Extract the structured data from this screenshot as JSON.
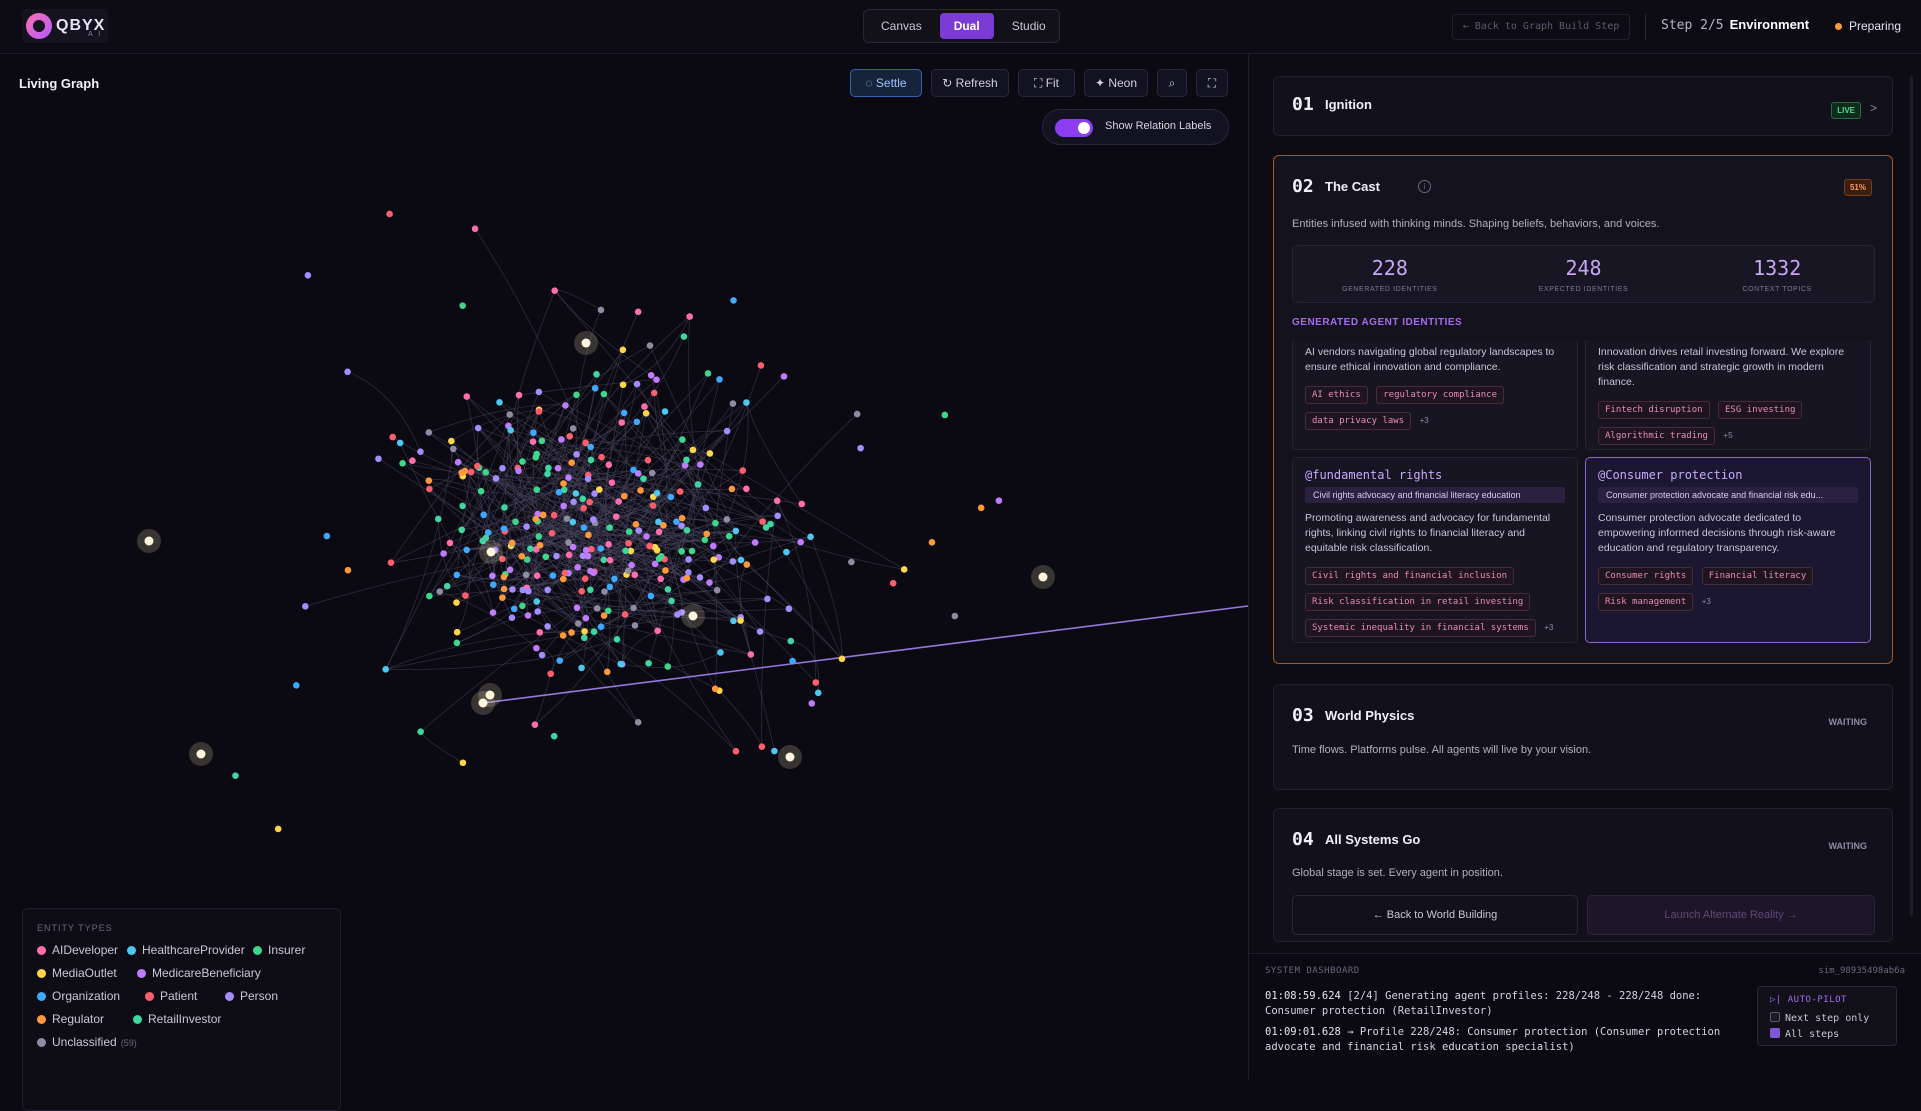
{
  "app": {
    "logo_text": "QBYX",
    "logo_sub": "A I"
  },
  "modes": [
    "Canvas",
    "Dual",
    "Studio"
  ],
  "active_mode": "Dual",
  "header": {
    "back_link": "← Back to Graph Build Step",
    "step_text": "Step 2/5",
    "step_name": "Environment",
    "status": "Preparing",
    "status_color": "#ff9a3c"
  },
  "graph": {
    "title": "Living Graph",
    "toolbar": {
      "settle": "Settle",
      "refresh": "Refresh",
      "fit": "Fit",
      "neon": "Neon"
    },
    "toggle_label": "Show Relation Labels",
    "toggle_on": true,
    "legend_title": "ENTITY TYPES",
    "legend": [
      {
        "label": "AIDeveloper",
        "color": "#ff6fae"
      },
      {
        "label": "HealthcareProvider",
        "color": "#4fc8f0"
      },
      {
        "label": "Insurer",
        "color": "#3fd68c"
      },
      {
        "label": "MediaOutlet",
        "color": "#ffd54a"
      },
      {
        "label": "MedicareBeneficiary",
        "color": "#c07cff"
      },
      {
        "label": "Organization",
        "color": "#3fa8ff"
      },
      {
        "label": "Patient",
        "color": "#ff5f6d"
      },
      {
        "label": "Person",
        "color": "#a58cff"
      },
      {
        "label": "Regulator",
        "color": "#ff9a3c"
      },
      {
        "label": "RetailInvestor",
        "color": "#3fd6a0"
      },
      {
        "label": "Unclassified",
        "color": "#8f8ba3",
        "count": "(59)"
      }
    ]
  },
  "steps": {
    "s1": {
      "num": "01",
      "title": "Ignition",
      "badge": "LIVE",
      "chevron": ">"
    },
    "s2": {
      "num": "02",
      "title": "The Cast",
      "badge": "51%",
      "desc": "Entities infused with thinking minds. Shaping beliefs, behaviors, and voices.",
      "stats": [
        {
          "value": "228",
          "label": "GENERATED IDENTITIES"
        },
        {
          "value": "248",
          "label": "EXPECTED IDENTITIES"
        },
        {
          "value": "1332",
          "label": "CONTEXT TOPICS"
        }
      ],
      "section_title": "GENERATED AGENT IDENTITIES",
      "agents": [
        {
          "handle": "",
          "bio": "AI vendors navigating global regulatory landscapes to ensure ethical innovation and compliance.",
          "tags": [
            "AI ethics",
            "regulatory compliance",
            "data privacy laws"
          ],
          "more": "+3"
        },
        {
          "handle": "",
          "bio": "Innovation drives retail investing forward. We explore risk classification and strategic growth in modern finance.",
          "tags": [
            "Fintech disruption",
            "ESG investing",
            "Algorithmic trading"
          ],
          "more": "+5"
        },
        {
          "handle": "@fundamental rights",
          "role": "Civil rights advocacy and financial literacy education",
          "bio": "Promoting awareness and advocacy for fundamental rights, linking civil rights to financial literacy and equitable risk classification.",
          "tags": [
            "Civil rights and financial inclusion",
            "Risk classification in retail investing",
            "Systemic inequality in financial systems"
          ],
          "more": "+3"
        },
        {
          "handle": "@Consumer protection",
          "role": "Consumer protection advocate and financial risk edu...",
          "bio": "Consumer protection advocate dedicated to empowering informed decisions through risk-aware education and regulatory transparency.",
          "tags": [
            "Consumer rights",
            "Financial literacy",
            "Risk management"
          ],
          "more": "+3"
        }
      ]
    },
    "s3": {
      "num": "03",
      "title": "World Physics",
      "badge": "WAITING",
      "desc": "Time flows. Platforms pulse. All agents will live by your vision."
    },
    "s4": {
      "num": "04",
      "title": "All Systems Go",
      "badge": "WAITING",
      "desc": "Global stage is set. Every agent in position.",
      "back_button": "← Back to World Building",
      "launch_button": "Launch Alternate Reality →"
    }
  },
  "dashboard": {
    "title": "SYSTEM DASHBOARD",
    "session_id": "sim_98935498ab6a",
    "logs": [
      {
        "time": "01:08:59.624",
        "text": "[2/4] Generating agent profiles: 228/248 - 228/248 done: Consumer protection (RetailInvestor)"
      },
      {
        "time": "01:09:01.628",
        "text": "→ Profile 228/248: Consumer protection (Consumer protection advocate and financial risk education specialist)"
      }
    ],
    "autopilot": {
      "title": "AUTO-PILOT",
      "next_step": "Next step only",
      "all_steps": "All steps",
      "next_checked": false,
      "all_checked": true
    }
  }
}
